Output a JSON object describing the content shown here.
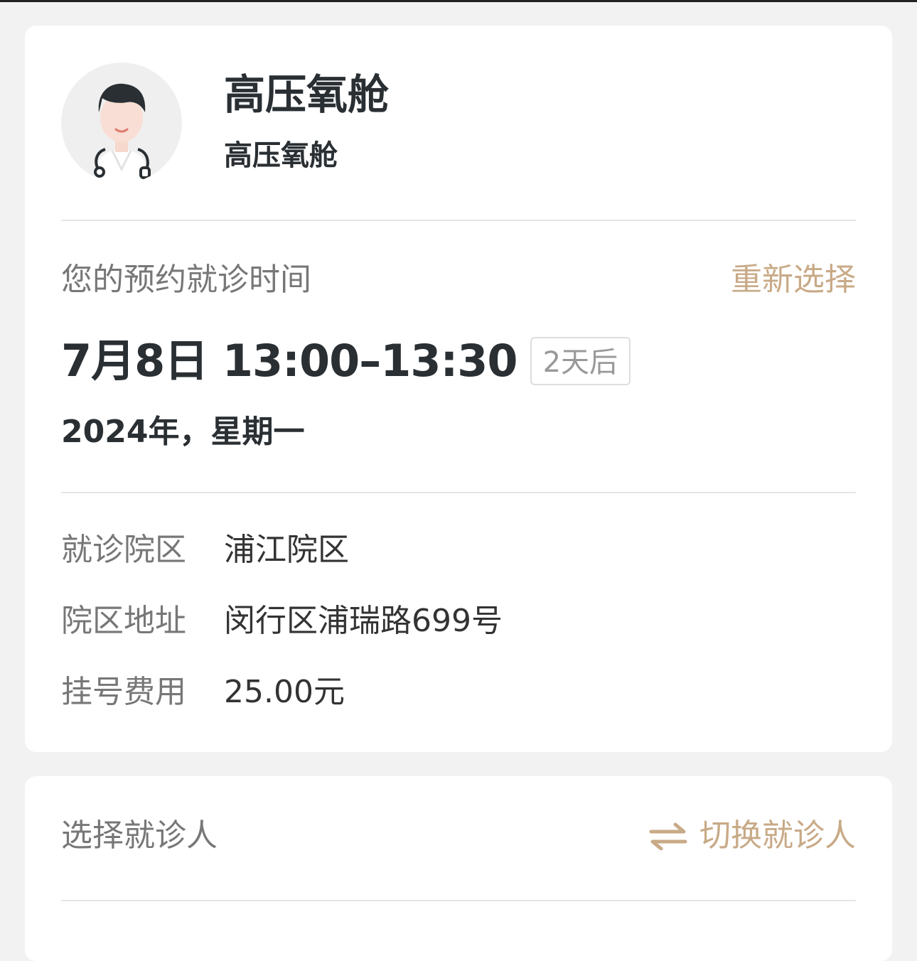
{
  "doctor": {
    "avatar_icon": "doctor-avatar-icon",
    "name": "高压氧舱",
    "department": "高压氧舱"
  },
  "appointment": {
    "label": "您的预约就诊时间",
    "reselect_label": "重新选择",
    "date_time": "7月8日 13:00–13:30",
    "days_badge": "2天后",
    "year_weekday": "2024年，星期一"
  },
  "info": [
    {
      "label": "就诊院区",
      "value": "浦江院区"
    },
    {
      "label": "院区地址",
      "value": "闵行区浦瑞路699号"
    },
    {
      "label": "挂号费用",
      "value": "25.00元"
    }
  ],
  "patient": {
    "label": "选择就诊人",
    "switch_label": "切换就诊人",
    "switch_icon": "swap-arrows-icon"
  },
  "colors": {
    "accent": "#c8aa87",
    "background": "#f2f2f2",
    "card": "#ffffff",
    "title_text": "#2a2f33",
    "muted_text": "#777777"
  }
}
